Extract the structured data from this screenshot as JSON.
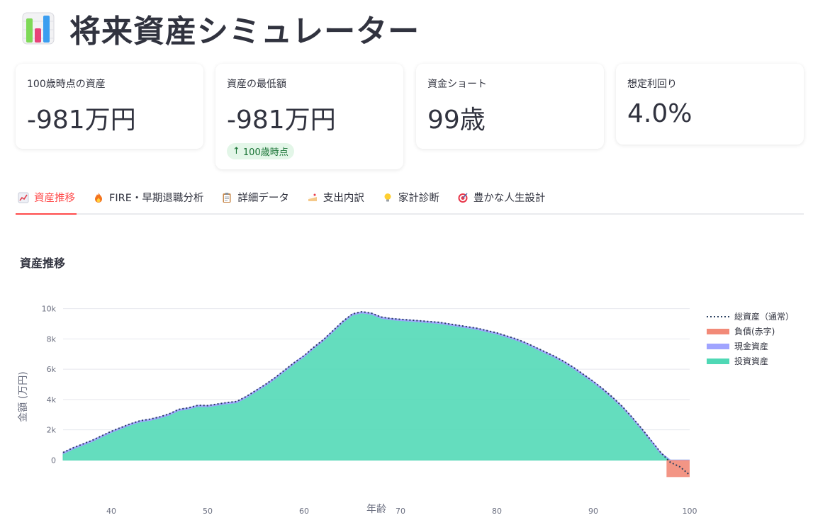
{
  "header": {
    "title": "将来資産シミュレーター",
    "icon": "bar-chart-icon"
  },
  "metrics": [
    {
      "label": "100歳時点の資産",
      "value": "-981万円"
    },
    {
      "label": "資産の最低額",
      "value": "-981万円",
      "delta": "100歳時点"
    },
    {
      "label": "資金ショート",
      "value": "99歳"
    },
    {
      "label": "想定利回り",
      "value": "4.0%"
    }
  ],
  "tabs": [
    {
      "label": "資産推移",
      "icon": "chart-increasing-icon",
      "active": true
    },
    {
      "label": "FIRE・早期退職分析",
      "icon": "fire-icon"
    },
    {
      "label": "詳細データ",
      "icon": "clipboard-icon"
    },
    {
      "label": "支出内訳",
      "icon": "cake-icon"
    },
    {
      "label": "家計診断",
      "icon": "light-bulb-icon"
    },
    {
      "label": "豊かな人生設計",
      "icon": "target-icon"
    }
  ],
  "section": {
    "title": "資産推移"
  },
  "colors": {
    "accent": "#ff4b4b",
    "invest": "#4fd8b5",
    "cash": "#a0a4ff",
    "debt": "#f28a78",
    "total": "#2a3f5f"
  },
  "chart_data": {
    "type": "area",
    "xlabel": "年齢",
    "ylabel": "金額 (万円)",
    "xlim": [
      35,
      100
    ],
    "ylim": [
      -1200,
      10500
    ],
    "x_ticks": [
      40,
      50,
      60,
      70,
      80,
      90,
      100
    ],
    "y_ticks": [
      0,
      2000,
      4000,
      6000,
      8000,
      10000
    ],
    "y_tick_labels": [
      "0",
      "2k",
      "4k",
      "6k",
      "8k",
      "10k"
    ],
    "legend_position": "right",
    "x": [
      35,
      36,
      37,
      38,
      39,
      40,
      41,
      42,
      43,
      44,
      45,
      46,
      47,
      48,
      49,
      50,
      51,
      52,
      53,
      54,
      55,
      56,
      57,
      58,
      59,
      60,
      61,
      62,
      63,
      64,
      65,
      66,
      67,
      68,
      69,
      70,
      71,
      72,
      73,
      74,
      75,
      76,
      77,
      78,
      79,
      80,
      81,
      82,
      83,
      84,
      85,
      86,
      87,
      88,
      89,
      90,
      91,
      92,
      93,
      94,
      95,
      96,
      97,
      98,
      99,
      100
    ],
    "series": [
      {
        "name": "総資産（通常）",
        "kind": "line",
        "values": [
          500,
          800,
          1050,
          1300,
          1600,
          1900,
          2150,
          2400,
          2600,
          2700,
          2850,
          3050,
          3350,
          3450,
          3620,
          3600,
          3700,
          3800,
          3870,
          4200,
          4600,
          5000,
          5450,
          5950,
          6450,
          6900,
          7450,
          7950,
          8550,
          9150,
          9650,
          9800,
          9700,
          9450,
          9350,
          9300,
          9250,
          9200,
          9150,
          9100,
          9000,
          8900,
          8800,
          8700,
          8550,
          8400,
          8200,
          8000,
          7750,
          7450,
          7150,
          6850,
          6500,
          6100,
          5650,
          5200,
          4700,
          4150,
          3550,
          2850,
          2100,
          1300,
          500,
          -150,
          -450,
          -981
        ]
      },
      {
        "name": "負債(赤字)",
        "kind": "area",
        "values": [
          0,
          0,
          0,
          0,
          0,
          0,
          0,
          0,
          0,
          0,
          0,
          0,
          0,
          0,
          0,
          0,
          0,
          0,
          0,
          0,
          0,
          0,
          0,
          0,
          0,
          0,
          0,
          0,
          0,
          0,
          0,
          0,
          0,
          0,
          0,
          0,
          0,
          0,
          0,
          0,
          0,
          0,
          0,
          0,
          0,
          0,
          0,
          0,
          0,
          0,
          0,
          0,
          0,
          0,
          0,
          0,
          0,
          0,
          0,
          0,
          0,
          0,
          0,
          -150,
          -450,
          -981
        ]
      },
      {
        "name": "現金資産",
        "kind": "area",
        "values": [
          80,
          80,
          80,
          80,
          80,
          80,
          80,
          80,
          80,
          80,
          80,
          80,
          80,
          80,
          80,
          80,
          80,
          80,
          80,
          80,
          80,
          80,
          80,
          80,
          80,
          80,
          80,
          80,
          80,
          80,
          80,
          80,
          80,
          80,
          80,
          80,
          80,
          80,
          80,
          80,
          80,
          80,
          80,
          80,
          80,
          80,
          80,
          80,
          80,
          80,
          80,
          80,
          80,
          80,
          80,
          80,
          80,
          80,
          80,
          80,
          80,
          80,
          80,
          0,
          0,
          0
        ]
      },
      {
        "name": "投資資産",
        "kind": "area",
        "values": [
          420,
          720,
          970,
          1220,
          1520,
          1820,
          2070,
          2320,
          2520,
          2620,
          2770,
          2970,
          3270,
          3370,
          3540,
          3520,
          3620,
          3720,
          3790,
          4120,
          4520,
          4920,
          5370,
          5870,
          6370,
          6820,
          7370,
          7870,
          8470,
          9070,
          9570,
          9720,
          9620,
          9370,
          9270,
          9220,
          9170,
          9120,
          9070,
          9020,
          8920,
          8820,
          8720,
          8620,
          8470,
          8320,
          8120,
          7920,
          7670,
          7370,
          7070,
          6770,
          6420,
          6020,
          5570,
          5120,
          4620,
          4070,
          3470,
          2770,
          2020,
          1220,
          420,
          0,
          0,
          0
        ]
      }
    ]
  }
}
